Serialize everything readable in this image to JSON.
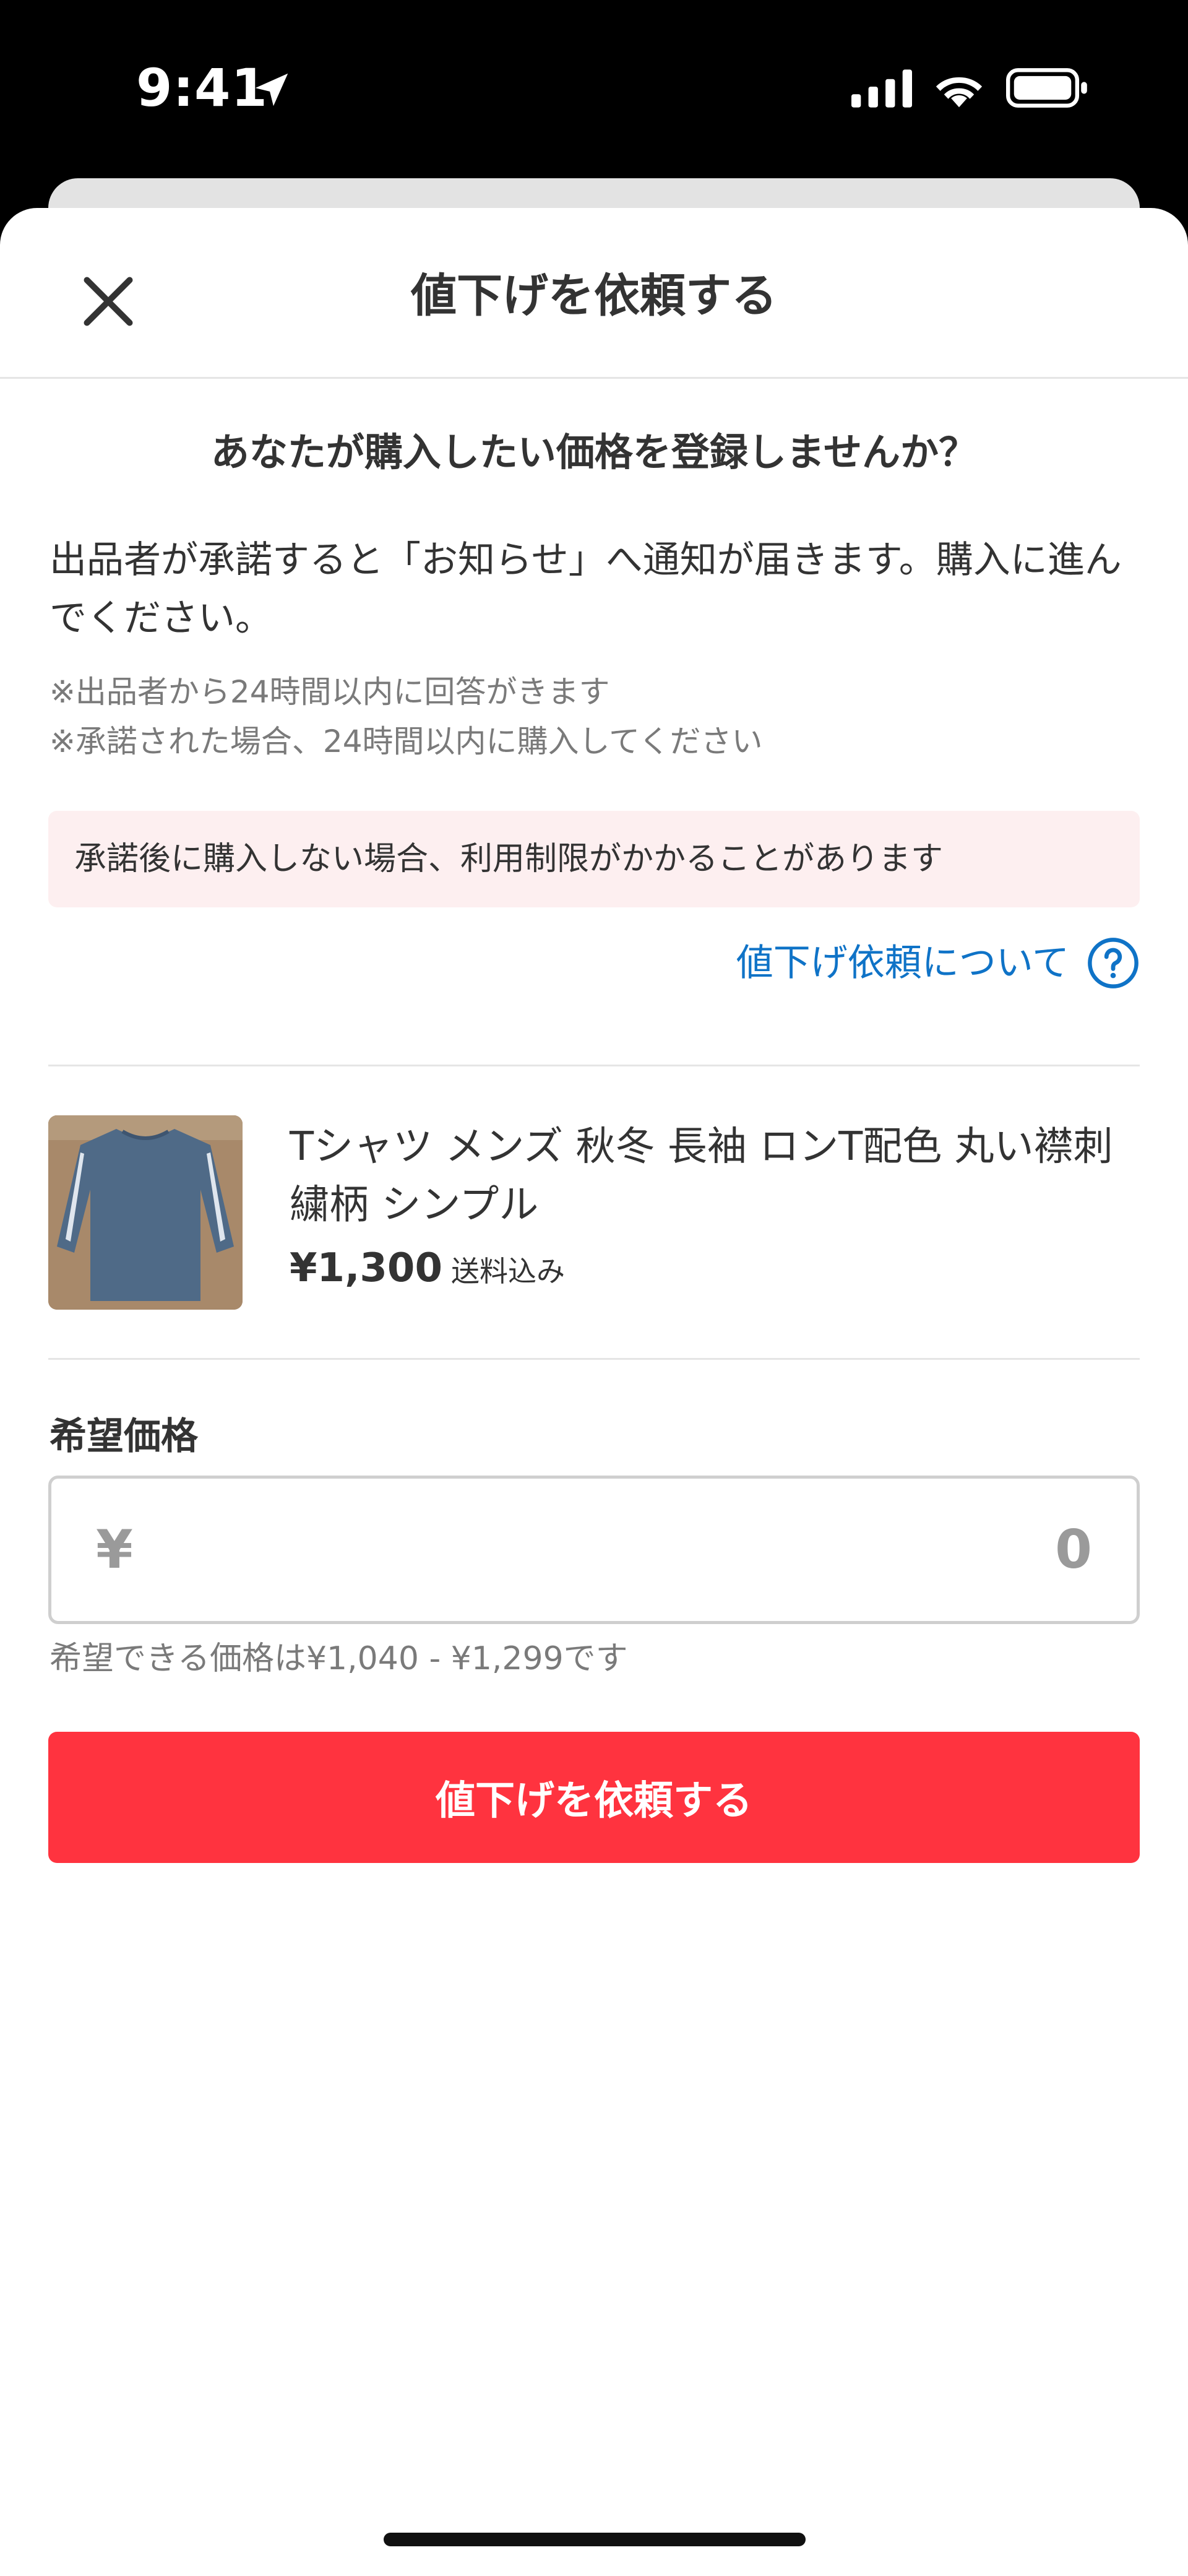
{
  "status_bar": {
    "time": "9:41",
    "icons": [
      "location-arrow-icon",
      "cellular-signal-icon",
      "wifi-icon",
      "battery-icon"
    ]
  },
  "header": {
    "title": "値下げを依頼する",
    "close_icon": "close-icon"
  },
  "intro": {
    "heading": "あなたが購入したい価格を登録しませんか？",
    "description": "出品者が承諾すると「お知らせ」へ通知が届きます。購入に進んでください。",
    "notes": [
      "※出品者から24時間以内に回答がきます",
      "※承諾された場合、24時間以内に購入してください"
    ],
    "warning": "承諾後に購入しない場合、利用制限がかかることがあります",
    "help_link": "値下げ依頼について",
    "help_icon": "question-circle-icon"
  },
  "product": {
    "name": "Tシャツ メンズ 秋冬 長袖 ロンT配色 丸い襟刺繍柄 シンプル",
    "price": "¥1,300",
    "shipping": "送料込み",
    "thumbnail_icon": "product-photo"
  },
  "price_form": {
    "label": "希望価格",
    "currency_symbol": "¥",
    "value": "0",
    "range_note": "希望できる価格は¥1,040 - ¥1,299です",
    "submit_label": "値下げを依頼する"
  },
  "colors": {
    "accent_red": "#ff333f",
    "link_blue": "#0f73c7",
    "warning_bg": "#fdeff0"
  }
}
